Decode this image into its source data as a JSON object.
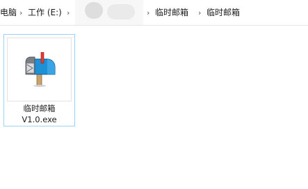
{
  "breadcrumb": {
    "items": [
      "电脑",
      "工作 (E:)",
      "临时邮箱",
      "临时邮箱"
    ],
    "separator": "›"
  },
  "file": {
    "name_line1": "临时邮箱",
    "name_line2": "V1.0.exe",
    "icon": "mailbox-icon"
  },
  "colors": {
    "selection_border": "#99d1ff",
    "mailbox_body": "#1e90d6",
    "mailbox_flag": "#e03c31"
  }
}
